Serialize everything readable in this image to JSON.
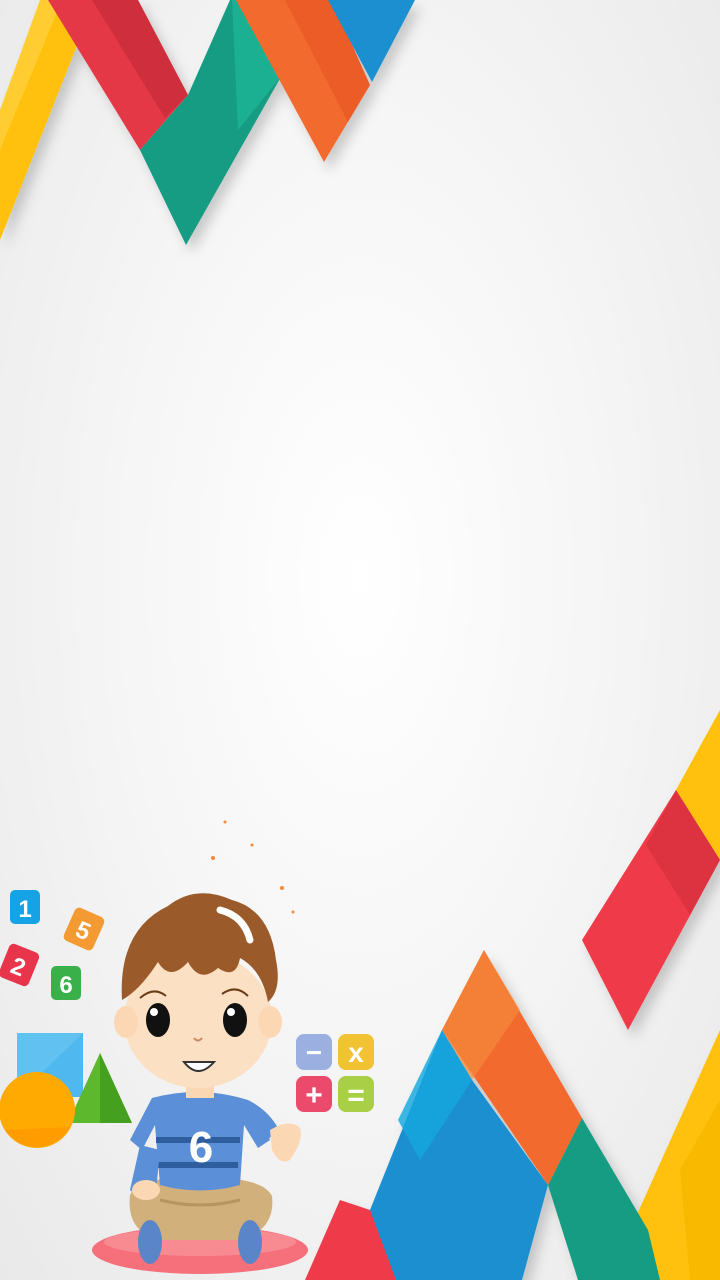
{
  "screen": {
    "name": "kids math splash background"
  },
  "colors": {
    "yellow": "#FFC107",
    "red": "#EF3B4A",
    "green": "#14A085",
    "orange": "#F26A2E",
    "blue": "#1E8FD0",
    "tile_blue": "#16A3E6",
    "tile_red": "#E8354B",
    "tile_orange": "#F39A33",
    "tile_green": "#39B04A",
    "minus_tile": "#9BAFE0",
    "times_tile": "#F1C232",
    "plus_tile": "#EC4A6D",
    "equals_tile": "#A8CF45"
  },
  "number_tiles": [
    "1",
    "5",
    "2",
    "6"
  ],
  "operator_tiles": [
    "−",
    "x",
    "+",
    "="
  ],
  "character": {
    "shirt_number": "6"
  }
}
